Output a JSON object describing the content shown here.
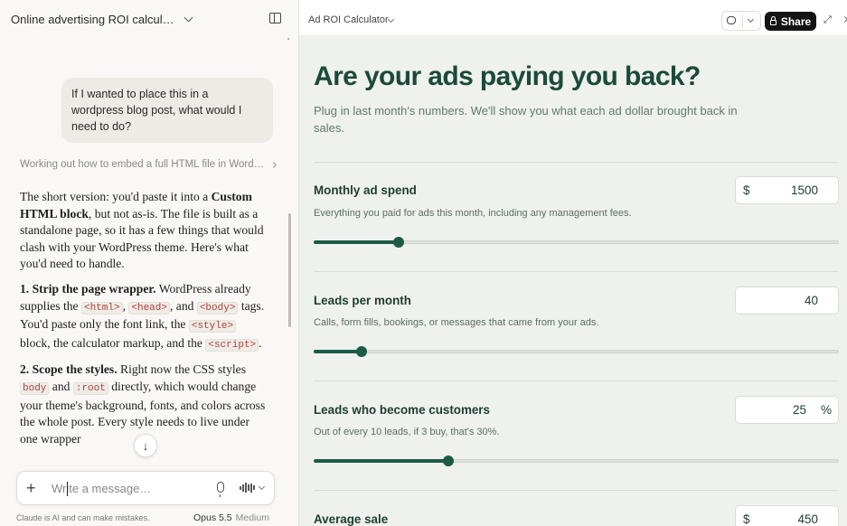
{
  "chat": {
    "title": "Online advertising ROI calcul…",
    "user_message": "If I wanted to place this in a wordpress blog post, what would I need to do?",
    "thinking_summary": "Working out how to embed a full HTML file in Word…",
    "answer": {
      "intro_1": "The short version: you'd paste it into a ",
      "intro_bold": "Custom HTML block",
      "intro_2": ", but not as-is. The file is built as a standalone page, so it has a few things that would clash with your WordPress theme. Here's what you'd need to handle.",
      "step1_title": "1. Strip the page wrapper.",
      "step1_a": " WordPress already supplies the ",
      "step1_code1": "<html>",
      "step1_b": ", ",
      "step1_code2": "<head>",
      "step1_c": ", and ",
      "step1_code3": "<body>",
      "step1_d": " tags. You'd paste only the font link, the ",
      "step1_code4": "<style>",
      "step1_e": " block, the calculator markup, and the ",
      "step1_code5": "<script>",
      "step1_f": ".",
      "step2_title": "2. Scope the styles.",
      "step2_a": " Right now the CSS styles ",
      "step2_code1": "body",
      "step2_b": " and ",
      "step2_code2": ":root",
      "step2_c": " directly, which would change your theme's background, fonts, and colors across the whole post. Every style needs to live under one wrapper"
    },
    "composer_placeholder": "Write a message…",
    "disclaimer": "Claude is AI and can make mistakes.",
    "model_name": "Opus 5.5",
    "model_level": "Medium"
  },
  "artifact": {
    "title": "Ad ROI Calculator",
    "share_label": "Share",
    "headline": "Are your ads paying you back?",
    "subhead": "Plug in last month's numbers. We'll show you what each ad dollar brought back in sales.",
    "fields": [
      {
        "label": "Monthly ad spend",
        "help": "Everything you paid for ads this month, including any management fees.",
        "prefix": "$",
        "suffix": "",
        "value": "1500",
        "slider_fraction": 0.16
      },
      {
        "label": "Leads per month",
        "help": "Calls, form fills, bookings, or messages that came from your ads.",
        "prefix": "",
        "suffix": "",
        "value": "40",
        "slider_fraction": 0.09
      },
      {
        "label": "Leads who become customers",
        "help": "Out of every 10 leads, if 3 buy, that's 30%.",
        "prefix": "",
        "suffix": "%",
        "value": "25",
        "slider_fraction": 0.255
      },
      {
        "label": "Average sale",
        "help": "",
        "prefix": "$",
        "suffix": "",
        "value": "450",
        "slider_fraction": 0
      }
    ]
  },
  "colors": {
    "accent_green": "#1d5b48",
    "headline_green": "#1b4a3b",
    "panel_bg": "#eff1ee"
  }
}
